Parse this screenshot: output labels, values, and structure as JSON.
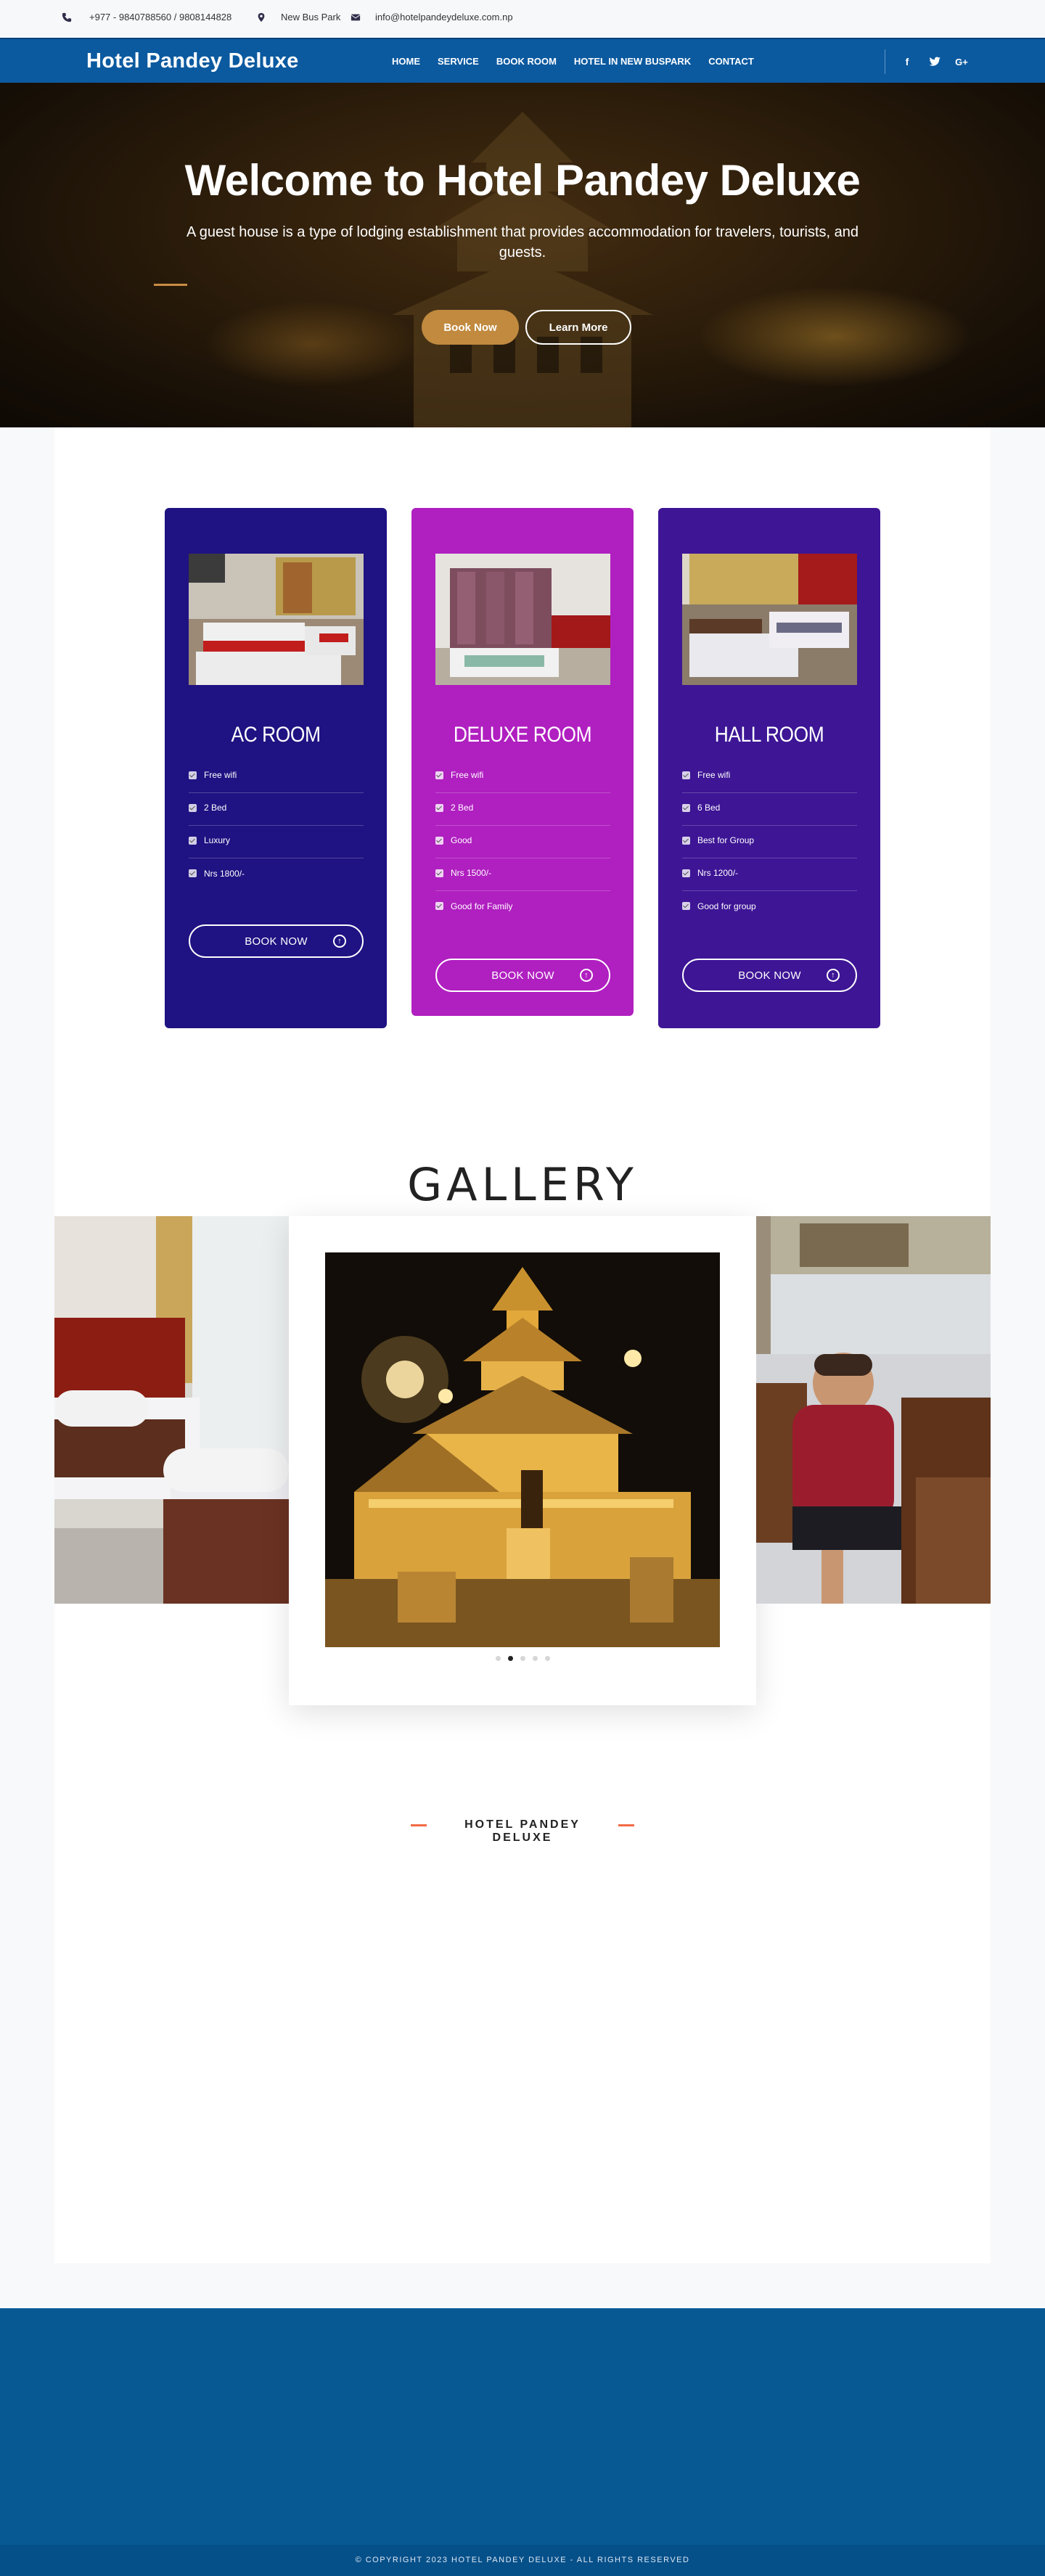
{
  "topbar": {
    "phone": "+977 - 9840788560 / 9808144828",
    "address": "New Bus Park",
    "email": "info@hotelpandeydeluxe.com.np"
  },
  "nav": {
    "brand": "Hotel Pandey Deluxe",
    "links": [
      "HOME",
      "SERVICE",
      "BOOK ROOM",
      "HOTEL IN NEW BUSPARK",
      "CONTACT"
    ],
    "social": [
      "f",
      "twitter-bird",
      "G+"
    ]
  },
  "hero": {
    "title": "Welcome to Hotel Pandey Deluxe",
    "subtitle": "A guest house is a type of lodging establishment that provides accommodation for travelers, tourists, and guests.",
    "book_label": "Book Now",
    "learn_label": "Learn More"
  },
  "rooms": [
    {
      "title": "AC ROOM",
      "features": [
        "Free wifi",
        "2 Bed",
        "Luxury",
        "Nrs 1800/-"
      ],
      "button": "BOOK NOW",
      "color": "#1f1282"
    },
    {
      "title": "DELUXE ROOM",
      "features": [
        "Free wifi",
        "2 Bed",
        "Good",
        "Nrs 1500/-",
        "Good for Family"
      ],
      "button": "BOOK NOW",
      "color": "#b01fc0"
    },
    {
      "title": "HALL ROOM",
      "features": [
        "Free wifi",
        "6 Bed",
        "Best for Group",
        "Nrs 1200/-",
        "Good for group"
      ],
      "button": "BOOK NOW",
      "color": "#3d1595"
    }
  ],
  "gallery": {
    "title": "GALLERY",
    "slide_count": 5,
    "active_slide": 2
  },
  "about": {
    "title": "HOTEL PANDEY DELUXE"
  },
  "footer": {
    "copyright": "© COPYRIGHT 2023 HOTEL PANDEY DELUXE - ALL RIGHTS RESERVED"
  },
  "colors": {
    "nav_bg": "#0b5aa0",
    "accent_gold": "#c18a3f",
    "accent_orange": "#f26a45",
    "footer_bg": "#075994"
  }
}
